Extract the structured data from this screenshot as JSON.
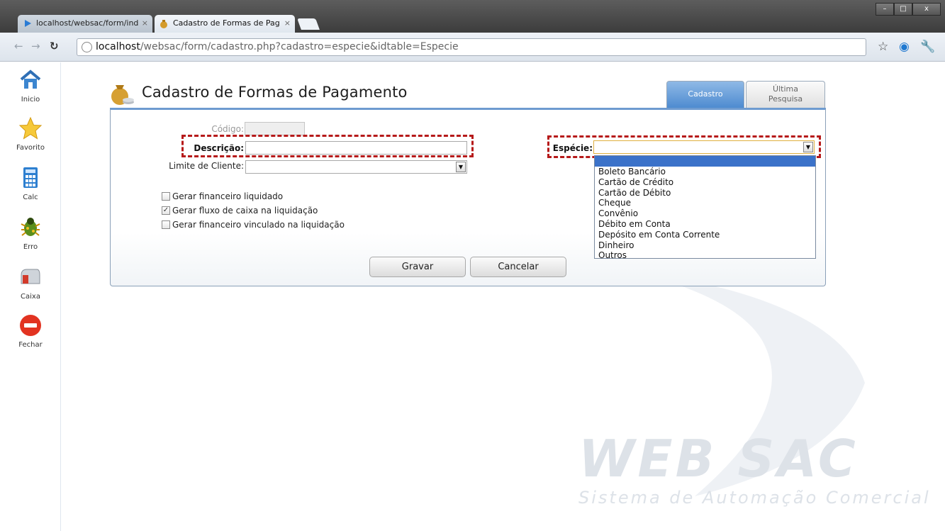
{
  "browser": {
    "tabs": [
      {
        "title": "localhost/websac/form/ind",
        "active": false
      },
      {
        "title": "Cadastro de Formas de Pag",
        "active": true
      }
    ],
    "close_glyph": "×",
    "url_host": "localhost",
    "url_path": "/websac/form/cadastro.php?cadastro=especie&idtable=Especie",
    "window_buttons": [
      "–",
      "□",
      "x"
    ]
  },
  "sidebar": {
    "items": [
      {
        "label": "Inicio",
        "icon": "home-icon"
      },
      {
        "label": "Favorito",
        "icon": "star-icon"
      },
      {
        "label": "Calc",
        "icon": "calculator-icon"
      },
      {
        "label": "Erro",
        "icon": "bug-icon"
      },
      {
        "label": "Caixa",
        "icon": "mailbox-icon"
      },
      {
        "label": "Fechar",
        "icon": "stop-icon"
      }
    ]
  },
  "page": {
    "title": "Cadastro de Formas de Pagamento",
    "tabs": {
      "cadastro": "Cadastro",
      "ultima_line1": "Última",
      "ultima_line2": "Pesquisa"
    }
  },
  "form": {
    "codigo_label": "Código:",
    "codigo_value": "",
    "descricao_label": "Descrição:",
    "descricao_value": "",
    "limite_label": "Limite de Cliente:",
    "limite_value": "",
    "especie_label": "Espécie:",
    "especie_value": "",
    "checkboxes": [
      {
        "label": "Gerar financeiro liquidado",
        "checked": false
      },
      {
        "label": "Gerar fluxo de caixa na liquidação",
        "checked": true
      },
      {
        "label": "Gerar financeiro vinculado na liquidação",
        "checked": false
      }
    ],
    "check_mark": "✓",
    "select_arrow": "▼",
    "especie_options": [
      "Boleto Bancário",
      "Cartão de Crédito",
      "Cartão de Débito",
      "Cheque",
      "Convênio",
      "Débito em Conta",
      "Depósito em Conta Corrente",
      "Dinheiro",
      "Outros"
    ]
  },
  "buttons": {
    "gravar": "Gravar",
    "cancelar": "Cancelar"
  },
  "watermark": {
    "brand": "WEB SAC",
    "tagline": "Sistema de Automação Comercial"
  },
  "colors": {
    "tab_accent": "#4e8bd0",
    "highlight": "#b61a1a",
    "selected_option": "#3b72c9"
  }
}
